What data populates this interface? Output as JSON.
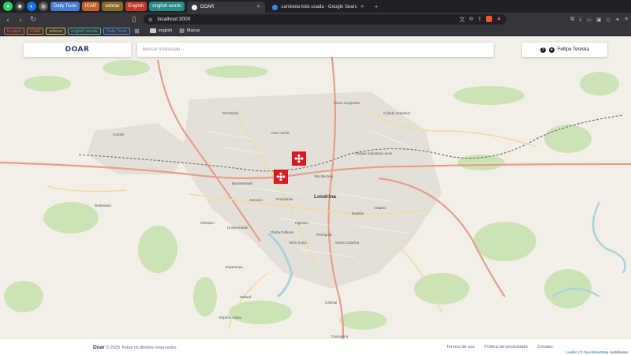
{
  "browser": {
    "pinned_icons": [
      "whatsapp-icon",
      "chrome-icon",
      "edge-icon",
      "github-icon"
    ],
    "tab_groups": [
      {
        "label": "Daily Tools",
        "color": "#4a7bd0"
      },
      {
        "label": "ICAR",
        "color": "#c2602e"
      },
      {
        "label": "sebrae",
        "color": "#8a6b2a"
      },
      {
        "label": "English",
        "color": "#c0392b"
      },
      {
        "label": "english words",
        "color": "#2b8a8a"
      }
    ],
    "tabs": [
      {
        "label": "DOAR",
        "active": true
      },
      {
        "label": "camiseta kids usada - Google Searc",
        "active": false
      }
    ],
    "url": "localhost:3000",
    "bookmark_groups": [
      {
        "label": "English",
        "color": "#e05a4f"
      },
      {
        "label": "ICAR",
        "color": "#d9822b"
      },
      {
        "label": "sebrae",
        "color": "#d4b94a"
      },
      {
        "label": "english words",
        "color": "#4fb3b3"
      },
      {
        "label": "Daily Tools",
        "color": "#5a8fe0"
      }
    ],
    "bookmarks": [
      {
        "label": "english",
        "icon": "folder-icon"
      },
      {
        "label": "Manus",
        "icon": "manus-icon"
      }
    ]
  },
  "app": {
    "logo": "DOAR",
    "search_placeholder": "Buscar Instituição...",
    "user_name": "Fellipe Tereska",
    "help_icon": "help-icon",
    "accent": "#d71920",
    "brand_color": "#1f3b73"
  },
  "map": {
    "labels": [
      "Cambé",
      "Londrina",
      "Vila Recreio",
      "Jamaica",
      "Bandeirantes",
      "Presidente",
      "Universidade",
      "Perobinha",
      "Ouro Verde",
      "Cinco Conjuntos",
      "Cidade Industrial",
      "Parque Industrial Leves",
      "Ingleses",
      "Petrópolis",
      "Bela Suíça",
      "Santa Catarina",
      "Brasília",
      "Antares",
      "Esperança",
      "Cafezal",
      "Gleba Palhano",
      "Olímpico",
      "Espírito Santo",
      "Sabará",
      "Bratislavia",
      "Guaravera"
    ],
    "markers": 2
  },
  "footer": {
    "brand": "Doar",
    "copyright": "© 2025 Todos os direitos reservados",
    "links": [
      "Termos de uso",
      "Política de privacidade",
      "Contato"
    ],
    "attribution_leaflet": "Leaflet",
    "attribution_sep": " | © ",
    "attribution_osm": "OpenStreetMap",
    "attribution_tail": " contributors"
  }
}
